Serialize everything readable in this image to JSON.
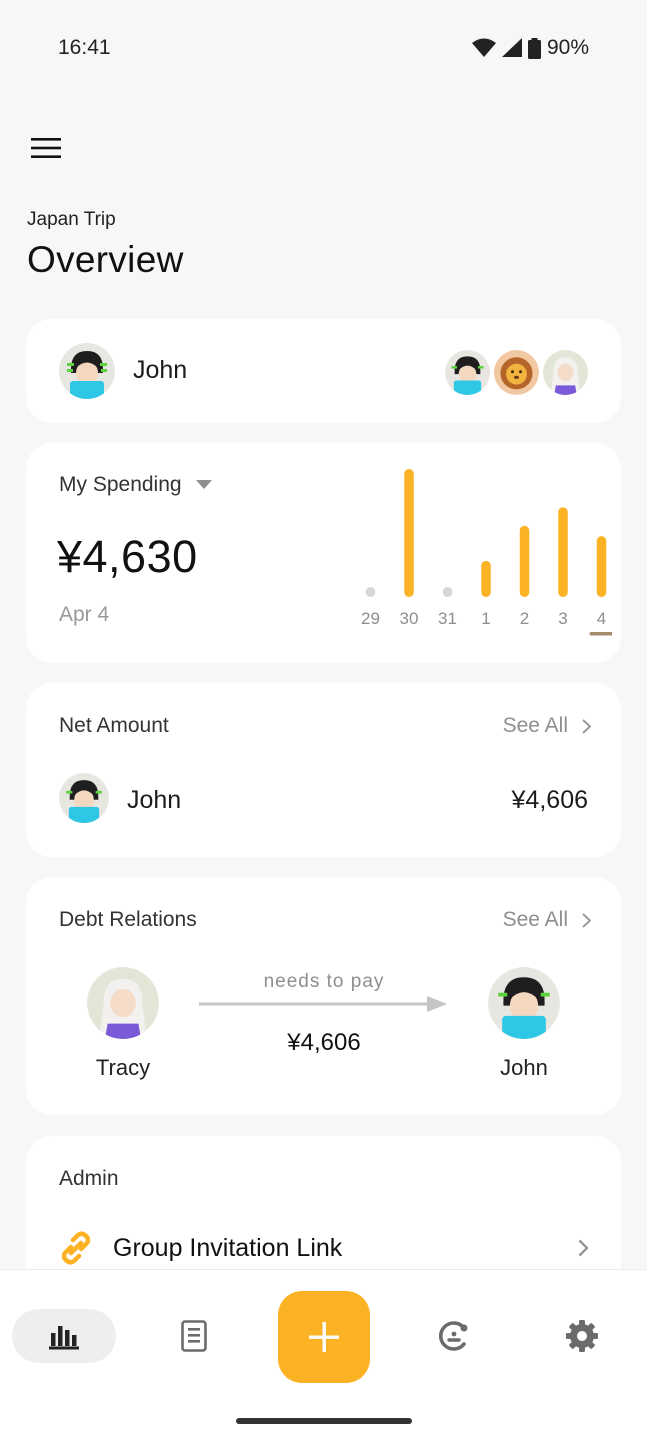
{
  "status": {
    "time": "16:41",
    "battery": "90%"
  },
  "header": {
    "group_name": "Japan Trip",
    "title": "Overview"
  },
  "member_card": {
    "name": "John"
  },
  "spending": {
    "label": "My Spending",
    "amount": "¥4,630",
    "date": "Apr 4"
  },
  "chart_data": {
    "type": "bar",
    "categories": [
      "29",
      "30",
      "31",
      "1",
      "2",
      "3",
      "4"
    ],
    "values": [
      0,
      6200,
      0,
      1750,
      3450,
      4350,
      2950
    ],
    "selected": "4",
    "colors": {
      "bar": "#fbb224",
      "empty": "#d6d6d6",
      "selected_underline": "#a78c6e"
    }
  },
  "net_amount": {
    "heading": "Net Amount",
    "see_all": "See All",
    "rows": [
      {
        "name": "John",
        "amount": "¥4,606"
      }
    ]
  },
  "debt_relations": {
    "heading": "Debt Relations",
    "see_all": "See All",
    "from": "Tracy",
    "to": "John",
    "verb": "needs to pay",
    "amount": "¥4,606"
  },
  "admin": {
    "heading": "Admin",
    "invite_label": "Group Invitation Link"
  },
  "nav": {
    "items": [
      "chart-icon",
      "receipt-icon",
      "add-icon",
      "people-icon",
      "settings-icon"
    ],
    "active": "chart-icon"
  },
  "colors": {
    "accent": "#fbb224",
    "card": "#ffffff",
    "background": "#f7f7f7"
  }
}
